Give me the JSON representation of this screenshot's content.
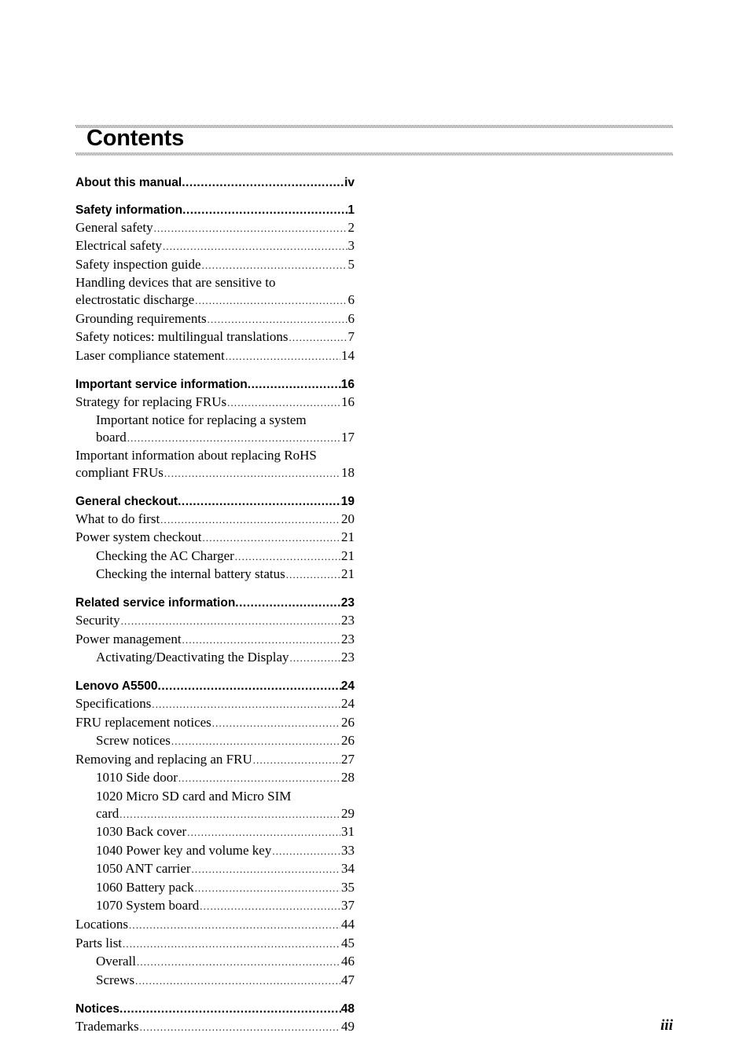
{
  "page": {
    "title": "Contents",
    "page_number": "iii"
  },
  "toc": [
    {
      "heading": {
        "text": "About this manual",
        "page": "iv"
      },
      "items": []
    },
    {
      "heading": {
        "text": "Safety information",
        "page": "1"
      },
      "items": [
        {
          "level": 1,
          "text": "General safety",
          "page": "2"
        },
        {
          "level": 1,
          "text": "Electrical safety",
          "page": "3"
        },
        {
          "level": 1,
          "text": "Safety inspection guide",
          "page": "5"
        },
        {
          "level": 1,
          "first_line": "Handling devices that are sensitive to",
          "text": "electrostatic discharge",
          "page": "6"
        },
        {
          "level": 1,
          "text": "Grounding requirements",
          "page": "6"
        },
        {
          "level": 1,
          "text": "Safety notices: multilingual translations",
          "page": "7"
        },
        {
          "level": 1,
          "text": "Laser compliance statement",
          "page": "14"
        }
      ]
    },
    {
      "heading": {
        "text": "Important service information",
        "page": "16"
      },
      "items": [
        {
          "level": 1,
          "text": "Strategy for replacing FRUs",
          "page": "16"
        },
        {
          "level": 2,
          "first_line": "Important notice for replacing a system",
          "text": "board",
          "page": "17"
        },
        {
          "level": 1,
          "first_line": "Important information about replacing RoHS",
          "text": "compliant FRUs",
          "page": "18"
        }
      ]
    },
    {
      "heading": {
        "text": "General checkout",
        "page": "19"
      },
      "items": [
        {
          "level": 1,
          "text": "What to do first",
          "page": "20"
        },
        {
          "level": 1,
          "text": "Power system checkout",
          "page": "21"
        },
        {
          "level": 2,
          "text": "Checking the AC Charger",
          "page": "21"
        },
        {
          "level": 2,
          "text": "Checking the internal battery status",
          "page": "21"
        }
      ]
    },
    {
      "heading": {
        "text": "Related service information",
        "page": "23"
      },
      "items": [
        {
          "level": 1,
          "text": "Security",
          "page": "23"
        },
        {
          "level": 1,
          "text": "Power management",
          "page": "23"
        },
        {
          "level": 2,
          "text": "Activating/Deactivating the Display",
          "page": "23"
        }
      ]
    },
    {
      "heading": {
        "text": "Lenovo A5500",
        "page": "24"
      },
      "items": [
        {
          "level": 1,
          "text": "Specifications",
          "page": "24"
        },
        {
          "level": 1,
          "text": "FRU replacement notices",
          "page": "26"
        },
        {
          "level": 2,
          "text": "Screw notices",
          "page": "26"
        },
        {
          "level": 1,
          "text": "Removing and replacing an FRU",
          "page": "27"
        },
        {
          "level": 2,
          "text": "1010 Side door",
          "page": "28"
        },
        {
          "level": 2,
          "first_line": "1020 Micro SD card and Micro SIM",
          "text": "card",
          "page": "29"
        },
        {
          "level": 2,
          "text": "1030 Back cover",
          "page": "31"
        },
        {
          "level": 2,
          "text": "1040 Power key and volume key",
          "page": "33"
        },
        {
          "level": 2,
          "text": "1050 ANT carrier",
          "page": "34"
        },
        {
          "level": 2,
          "text": "1060 Battery pack",
          "page": "35"
        },
        {
          "level": 2,
          "text": "1070 System board",
          "page": "37"
        },
        {
          "level": 1,
          "text": "Locations",
          "page": "44"
        },
        {
          "level": 1,
          "text": "Parts list",
          "page": "45"
        },
        {
          "level": 2,
          "text": "Overall",
          "page": "46"
        },
        {
          "level": 2,
          "text": "Screws",
          "page": "47"
        }
      ]
    },
    {
      "heading": {
        "text": "Notices",
        "page": "48"
      },
      "items": [
        {
          "level": 1,
          "text": "Trademarks",
          "page": "49"
        }
      ]
    }
  ]
}
